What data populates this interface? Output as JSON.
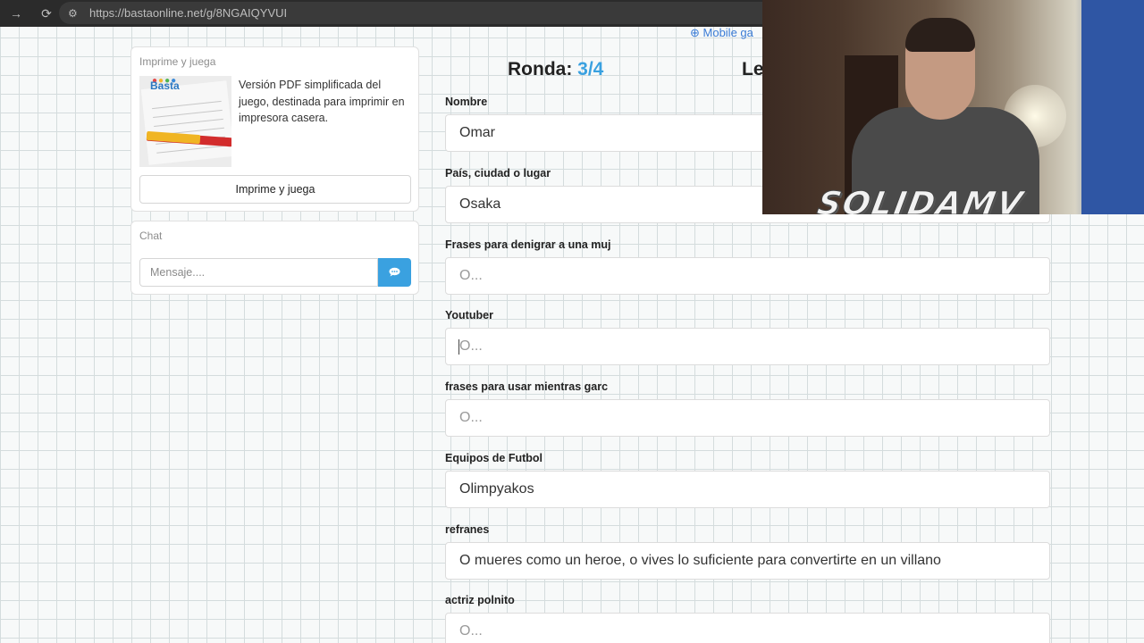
{
  "browser": {
    "url": "https://bastaonline.net/g/8NGAIQYVUI",
    "back_icon": "arrow-right-icon",
    "reload_icon": "reload-icon",
    "site_settings_icon": "tune-icon"
  },
  "print_card": {
    "title": "Imprime y juega",
    "description": "Versión PDF simplificada del juego, destinada para imprimir en impresora casera.",
    "button_label": "Imprime y juega"
  },
  "chat": {
    "title": "Chat",
    "placeholder": "Mensaje....",
    "send_icon": "chat-bubble-icon"
  },
  "header": {
    "mobile_link": "⊕ Mobile ga",
    "round_label": "Ronda:",
    "round_value": "3/4",
    "letter_label": "Le"
  },
  "fields": [
    {
      "label": "Nombre",
      "value": "Omar",
      "placeholder": "O..."
    },
    {
      "label": "País, ciudad o lugar",
      "value": "Osaka",
      "placeholder": "O..."
    },
    {
      "label": "Frases para denigrar a una muj",
      "value": "",
      "placeholder": "O..."
    },
    {
      "label": "Youtuber",
      "value": "",
      "placeholder": "O..."
    },
    {
      "label": "frases para usar mientras garc",
      "value": "",
      "placeholder": "O..."
    },
    {
      "label": "Equipos de Futbol",
      "value": "Olimpyakos",
      "placeholder": "O..."
    },
    {
      "label": "refranes",
      "value": "O mueres como un heroe, o vives lo suficiente para convertirte en un villano",
      "placeholder": "O..."
    },
    {
      "label": "actriz polnito",
      "value": "",
      "placeholder": "O..."
    }
  ],
  "webcam": {
    "overlay_text": "SOLIDAMV"
  },
  "colors": {
    "accent": "#3aa1e0",
    "browser_bar": "#2b2b2b"
  }
}
